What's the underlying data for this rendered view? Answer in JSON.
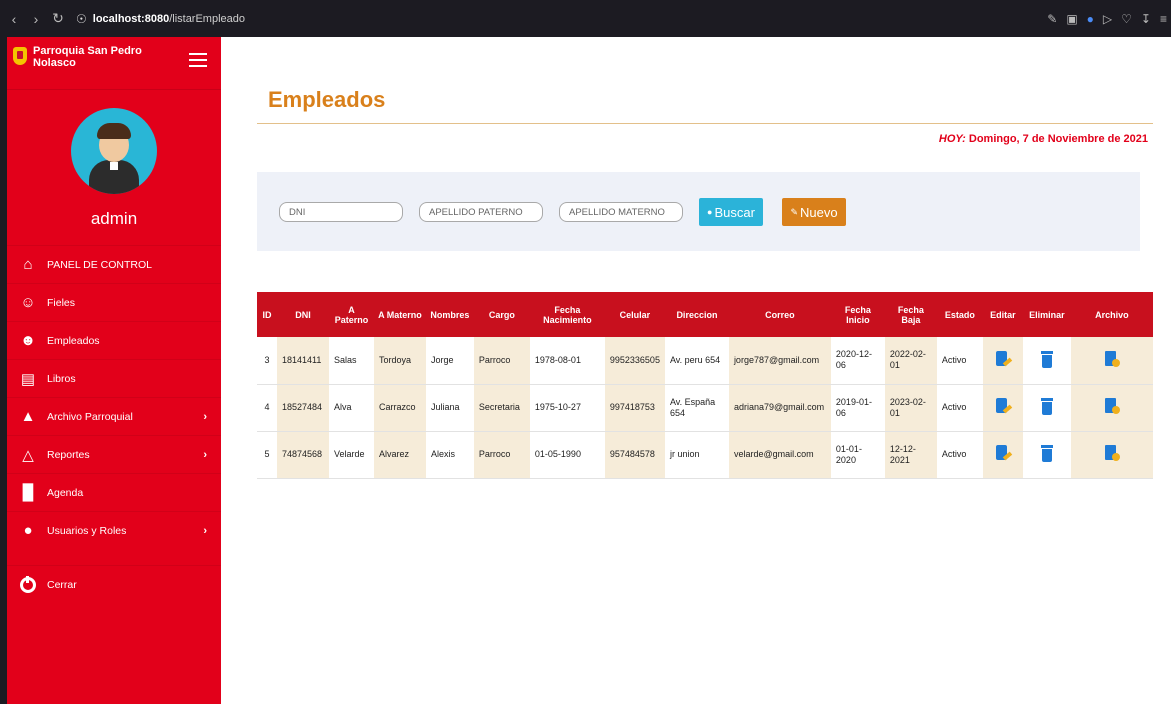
{
  "browser": {
    "url_host": "localhost:8080",
    "url_path": "/listarEmpleado"
  },
  "sidebar": {
    "brand": "Parroquia San Pedro Nolasco",
    "user": "admin",
    "items": [
      {
        "label": "PANEL DE CONTROL",
        "icon": "home-icon",
        "submenu": false
      },
      {
        "label": "Fieles",
        "icon": "people-icon",
        "submenu": false
      },
      {
        "label": "Empleados",
        "icon": "employee-icon",
        "submenu": false
      },
      {
        "label": "Libros",
        "icon": "books-icon",
        "submenu": false
      },
      {
        "label": "Archivo Parroquial",
        "icon": "church-icon",
        "submenu": true
      },
      {
        "label": "Reportes",
        "icon": "reports-icon",
        "submenu": true
      },
      {
        "label": "Agenda",
        "icon": "agenda-icon",
        "submenu": false
      },
      {
        "label": "Usuarios y Roles",
        "icon": "user-icon",
        "submenu": true
      }
    ],
    "logout": "Cerrar"
  },
  "main": {
    "title": "Empleados",
    "today_label": "HOY:",
    "today_value": "Domingo, 7 de Noviembre de 2021",
    "search": {
      "dni_placeholder": "DNI",
      "paterno_placeholder": "APELLIDO PATERNO",
      "materno_placeholder": "APELLIDO MATERNO",
      "buscar_label": "Buscar",
      "nuevo_label": "Nuevo"
    },
    "table": {
      "headers": [
        "ID",
        "DNI",
        "A Paterno",
        "A Materno",
        "Nombres",
        "Cargo",
        "Fecha Nacimiento",
        "Celular",
        "Direccion",
        "Correo",
        "Fecha Inicio",
        "Fecha Baja",
        "Estado",
        "Editar",
        "Eliminar",
        "Archivo"
      ],
      "rows": [
        [
          "3",
          "18141411",
          "Salas",
          "Tordoya",
          "Jorge",
          "Parroco",
          "1978-08-01",
          "9952336505",
          "Av. peru 654",
          "jorge787@gmail.com",
          "2020-12-06",
          "2022-02-01",
          "Activo"
        ],
        [
          "4",
          "18527484",
          "Alva",
          "Carrazco",
          "Juliana",
          "Secretaria",
          "1975-10-27",
          "997418753",
          "Av. España 654",
          "adriana79@gmail.com",
          "2019-01-06",
          "2023-02-01",
          "Activo"
        ],
        [
          "5",
          "74874568",
          "Velarde",
          "Alvarez",
          "Alexis",
          "Parroco",
          "01-05-1990",
          "957484578",
          "jr union",
          "velarde@gmail.com",
          "01-01-2020",
          "12-12-2021",
          "Activo"
        ]
      ]
    }
  },
  "colors": {
    "sidebar": "#e2001a",
    "accent": "#d9801b",
    "buscar": "#2bb3d9",
    "table_header": "#c8101e",
    "beige": "#f6ecd9"
  }
}
